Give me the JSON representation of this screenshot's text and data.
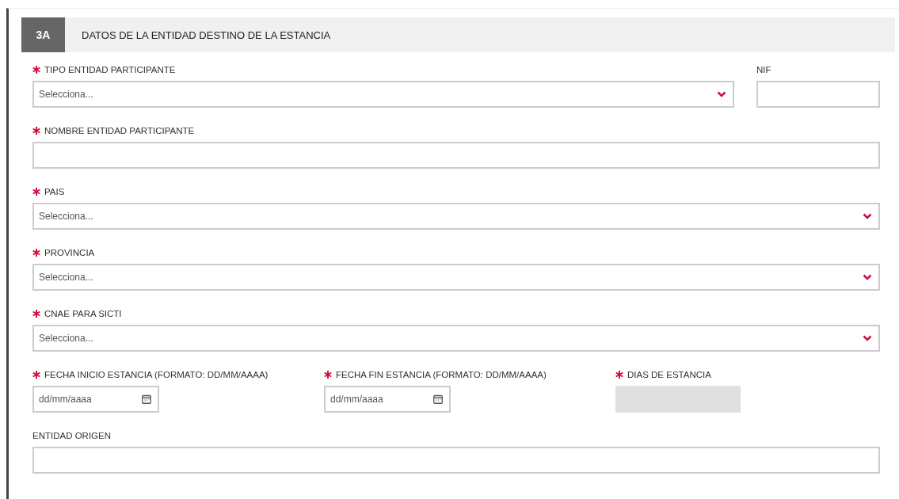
{
  "section": {
    "number": "3A",
    "title": "DATOS DE LA ENTIDAD DESTINO DE LA ESTANCIA"
  },
  "rows": [
    {
      "fields": [
        {
          "kind": "select",
          "label": "TIPO ENTIDAD PARTICIPANTE",
          "required": true,
          "placeholder": "Selecciona..."
        },
        {
          "kind": "short",
          "label": "NIF",
          "required": false
        }
      ]
    },
    {
      "fields": [
        {
          "kind": "text",
          "label": "NOMBRE ENTIDAD PARTICIPANTE",
          "required": true
        }
      ]
    },
    {
      "fields": [
        {
          "kind": "select",
          "label": "PAIS",
          "required": true,
          "placeholder": "Selecciona..."
        }
      ]
    },
    {
      "fields": [
        {
          "kind": "select",
          "label": "PROVINCIA",
          "required": true,
          "placeholder": "Selecciona..."
        }
      ]
    },
    {
      "fields": [
        {
          "kind": "select",
          "label": "CNAE PARA SICTI",
          "required": true,
          "placeholder": "Selecciona..."
        }
      ]
    },
    {
      "fields": [
        {
          "kind": "date",
          "label": "FECHA INICIO ESTANCIA (FORMATO: DD/MM/AAAA)",
          "required": true,
          "placeholder": "dd/mm/aaaa"
        },
        {
          "kind": "date",
          "label": "FECHA FIN ESTANCIA (FORMATO: DD/MM/AAAA)",
          "required": true,
          "placeholder": "dd/mm/aaaa"
        },
        {
          "kind": "readonly",
          "label": "DIAS DE ESTANCIA",
          "required": true
        }
      ]
    },
    {
      "fields": [
        {
          "kind": "text",
          "label": "ENTIDAD ORIGEN",
          "required": false
        }
      ]
    }
  ]
}
